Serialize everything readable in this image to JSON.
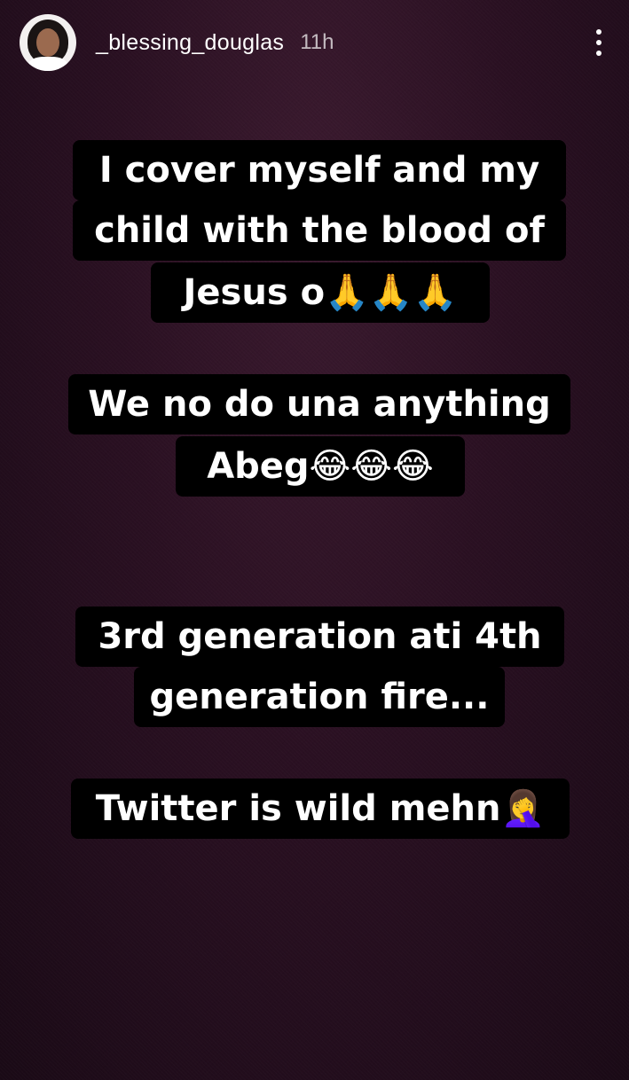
{
  "story": {
    "username": "_blessing_douglas",
    "time": "11h",
    "lines": [
      "I cover myself and my",
      "child with the blood of",
      "Jesus o🙏🙏🙏",
      "We no do una anything",
      "Abeg😂😂😂",
      "3rd generation ati 4th",
      "generation fire...",
      "Twitter is wild mehn🤦‍♀️"
    ]
  }
}
